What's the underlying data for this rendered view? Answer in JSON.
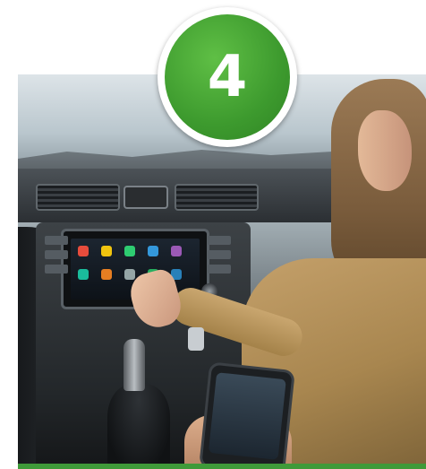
{
  "step": {
    "number": "4"
  },
  "colors": {
    "badge_green": "#3f9a39",
    "badge_border": "#ffffff",
    "bottom_bar": "#3f9a39"
  },
  "photo": {
    "subject": "photo-scene"
  },
  "infotainment": {
    "app_colors": [
      "#e74c3c",
      "#f1c40f",
      "#2ecc71",
      "#3498db",
      "#9b59b6",
      "#1abc9c",
      "#e67e22",
      "#95a5a6",
      "#27ae60",
      "#2980b9"
    ]
  }
}
